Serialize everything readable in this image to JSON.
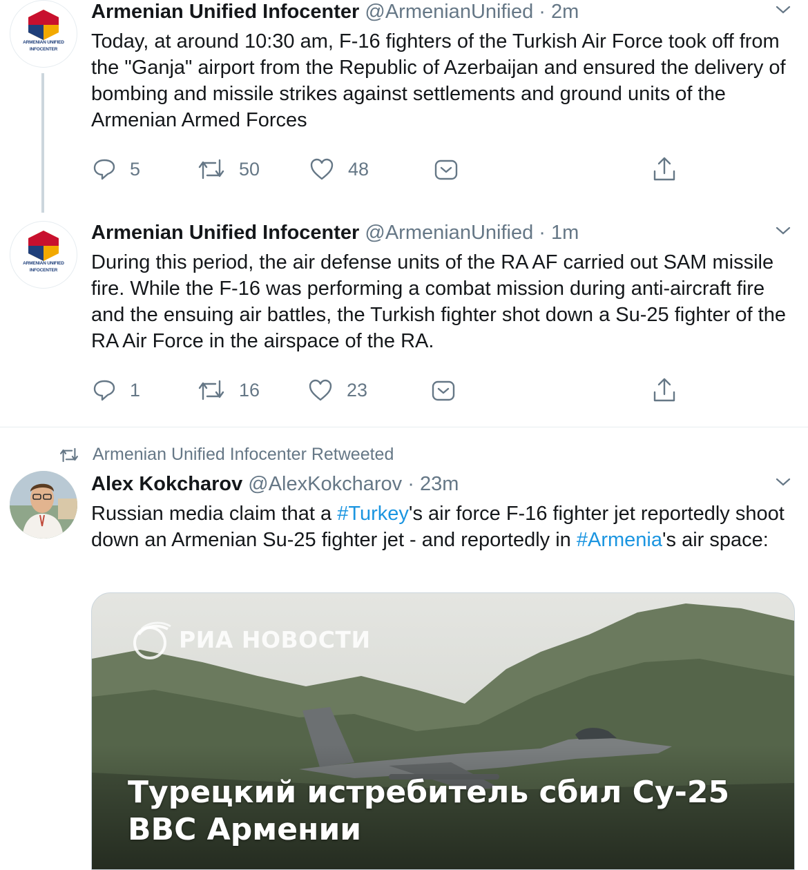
{
  "tweets": [
    {
      "author": "Armenian Unified Infocenter",
      "handle": "@ArmenianUnified",
      "separator": "·",
      "time": "2m",
      "text": "Today, at around 10:30 am, F-16 fighters of the Turkish Air Force took off from the \"Ganja\" airport from the Republic of Azerbaijan and ensured the delivery of bombing and missile strikes against settlements and ground units of the Armenian Armed Forces",
      "replies": "5",
      "retweets": "50",
      "likes": "48",
      "logo_text": [
        "ARMENIAN UNIFIED",
        "INFOCENTER"
      ]
    },
    {
      "author": "Armenian Unified Infocenter",
      "handle": "@ArmenianUnified",
      "separator": "·",
      "time": "1m",
      "text": "During this period, the air defense units of the RA AF carried out SAM missile fire. While the F-16 was performing a combat mission during anti-aircraft fire and the ensuing air battles, the Turkish fighter shot down a Su-25 fighter of the RA Air Force in the airspace of the RA.",
      "replies": "1",
      "retweets": "16",
      "likes": "23",
      "logo_text": [
        "ARMENIAN UNIFIED",
        "INFOCENTER"
      ]
    }
  ],
  "retweet": {
    "label": "Armenian Unified Infocenter Retweeted",
    "author": "Alex Kokcharov",
    "handle": "@AlexKokcharov",
    "separator": "·",
    "time": "23m",
    "text_parts": {
      "t1": "Russian media claim that a ",
      "tag1": "#Turkey",
      "t2": "'s air force F-16 fighter jet reportedly shoot down an Armenian Su-25 fighter jet - and reportedly in ",
      "tag2": "#Armenia",
      "t3": "'s air space:"
    },
    "card": {
      "watermark": "РИА НОВОСТИ",
      "title_line1": "Турецкий истребитель сбил Су-25",
      "title_line2": "ВВС Армении"
    }
  },
  "colors": {
    "link": "#1b95e0",
    "secondary": "#657786",
    "logo_red": "#c8102e",
    "logo_blue": "#1f3f7a",
    "logo_orange": "#f2a900"
  }
}
